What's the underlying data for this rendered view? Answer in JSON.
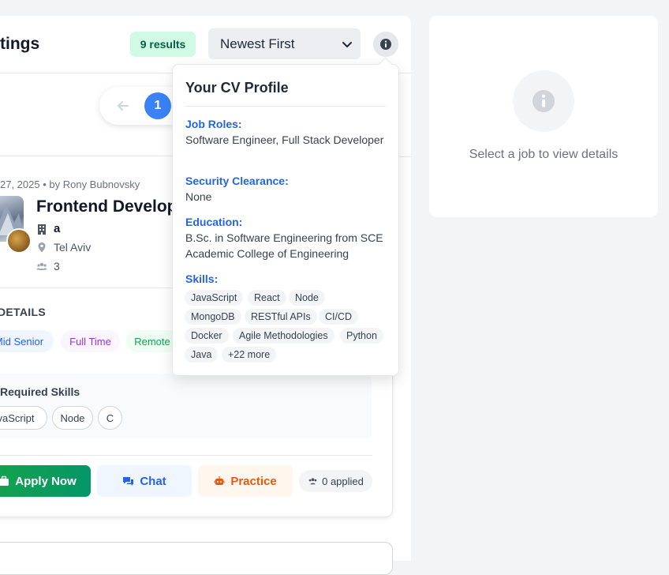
{
  "header": {
    "title": "tings",
    "results_badge": "9 results",
    "sort": {
      "selected": "Newest First"
    }
  },
  "pagination": {
    "current_page": "1"
  },
  "job": {
    "meta": "27, 2025 • by Rony Bubnovsky",
    "title": "Frontend Develop",
    "company": "a",
    "location": "Tel Aviv",
    "applicants": "3",
    "details_label": "DETAILS",
    "tags": [
      {
        "label": "Mid Senior",
        "color": "#2563eb"
      },
      {
        "label": "Full Time",
        "color": "#9333ea"
      },
      {
        "label": "Remote",
        "color": "#16a34a"
      }
    ],
    "required_skills_label": "Required Skills",
    "required_skills": [
      "vaScript",
      "Node",
      "C"
    ],
    "actions": {
      "apply": "Apply Now",
      "chat": "Chat",
      "practice": "Practice",
      "applied": "0 applied"
    }
  },
  "details_panel": {
    "empty_text": "Select a job to view details"
  },
  "cv_profile": {
    "title": "Your CV Profile",
    "job_roles_label": "Job Roles:",
    "job_roles_value": "Software Engineer, Full Stack Developer",
    "clearance_label": "Security Clearance:",
    "clearance_value": "None",
    "education_label": "Education:",
    "education_value": "B.Sc. in Software Engineering from SCE Academic College of Engineering",
    "skills_label": "Skills:",
    "skills": [
      "JavaScript",
      "React",
      "Node",
      "MongoDB",
      "RESTful APIs",
      "CI/CD",
      "Docker",
      "Agile Methodologies",
      "Python",
      "Java",
      "+22 more"
    ]
  },
  "icons": [
    "info-icon",
    "chevron-down-icon",
    "arrow-left-icon",
    "building-icon",
    "map-pin-icon",
    "users-icon",
    "briefcase-icon",
    "chat-icon",
    "robot-icon"
  ],
  "colors": {
    "primary": "#3b82f6",
    "success": "#16a34a",
    "link": "#2563eb",
    "orange": "#ea580c"
  }
}
